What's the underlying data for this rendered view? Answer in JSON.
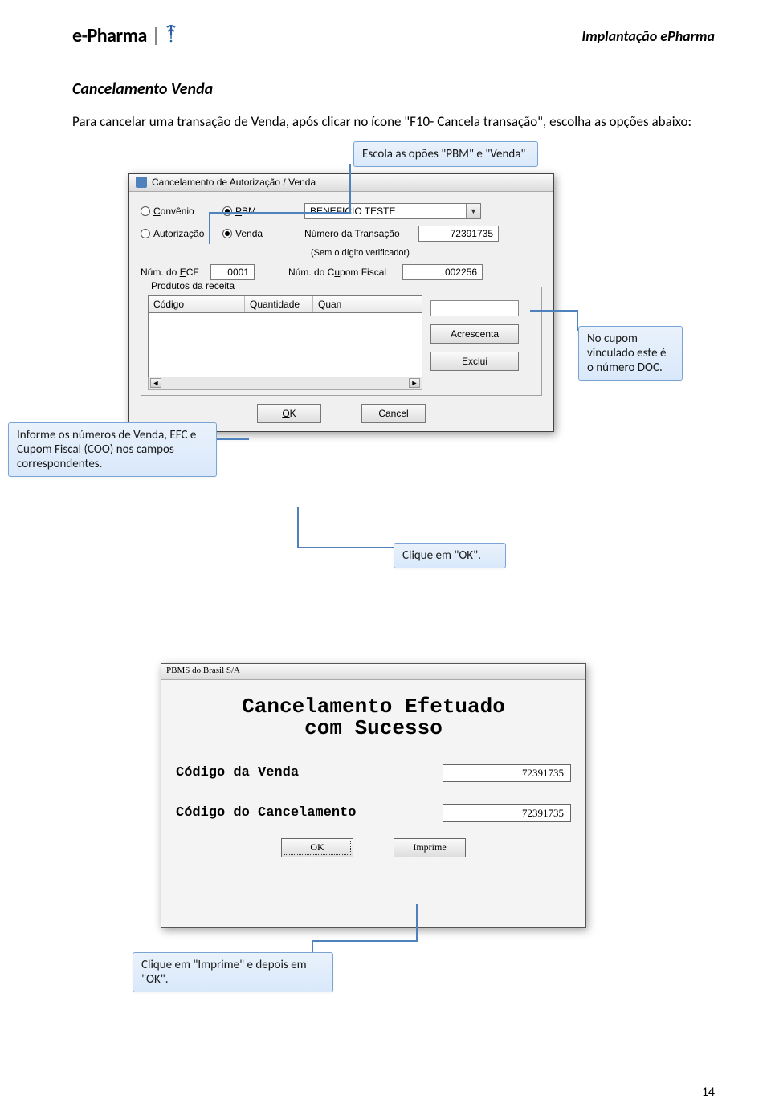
{
  "header": {
    "logo_e": "e",
    "logo_dash": "-",
    "logo_pharma": "Pharma",
    "right": "Implantação ePharma"
  },
  "section_title": "Cancelamento Venda",
  "intro": "Para cancelar uma transação de Venda, após clicar no ícone \"F10- Cancela transação\", escolha as opções abaixo:",
  "callouts": {
    "top": "Escola as opões \"PBM\" e \"Venda\"",
    "left": "Informe os números de Venda, EFC e Cupom Fiscal (COO) nos campos correspondentes.",
    "right": "No cupom vinculado este é o número DOC.",
    "ok": "Clique em \"OK\".",
    "bottom": "Clique em \"Imprime\" e depois em \"OK\"."
  },
  "dialog1": {
    "title": "Cancelamento de Autorização / Venda",
    "radio_convenio": "Convênio",
    "radio_pbm": "PBM",
    "radio_autorizacao": "Autorização",
    "radio_venda": "Venda",
    "sel_pbm_value": "BENEFICIO TESTE",
    "lbl_num_transacao": "Número da Transação",
    "val_num_transacao": "72391735",
    "lbl_sem_digito": "(Sem o dígito verificador)",
    "lbl_num_ecf": "Núm. do ECF",
    "val_num_ecf": "0001",
    "lbl_num_cupom": "Núm. do Cupom Fiscal",
    "val_num_cupom": "002256",
    "grp_legend": "Produtos da receita",
    "col_codigo": "Código",
    "col_quant": "Quantidade",
    "col_quan2": "Quan",
    "btn_acrescenta": "Acrescenta",
    "btn_exclui": "Exclui",
    "btn_ok": "OK",
    "btn_cancel": "Cancel"
  },
  "dialog2": {
    "title": "PBMS do Brasil S/A",
    "heading_l1": "Cancelamento Efetuado",
    "heading_l2": "com Sucesso",
    "lbl_cod_venda": "Código da Venda",
    "val_cod_venda": "72391735",
    "lbl_cod_canc": "Código do Cancelamento",
    "val_cod_canc": "72391735",
    "btn_ok": "OK",
    "btn_imprime": "Imprime"
  },
  "page_number": "14"
}
